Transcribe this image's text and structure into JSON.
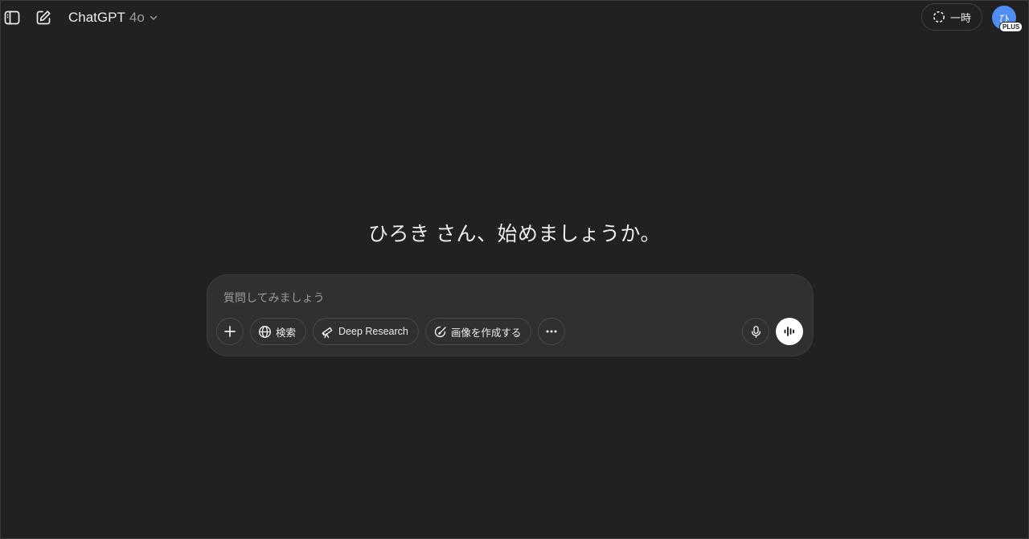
{
  "header": {
    "model_name": "ChatGPT",
    "model_version": "4o",
    "temporary_label": "一時",
    "avatar_initial": "ひ",
    "plan_badge": "PLUS"
  },
  "main": {
    "greeting": "ひろき さん、始めましょうか。"
  },
  "composer": {
    "placeholder": "質問してみましょう",
    "value": "",
    "tools": {
      "search_label": "検索",
      "deep_research_label": "Deep Research",
      "create_image_label": "画像を作成する"
    }
  },
  "icons": {
    "sidebar": "sidebar-toggle-icon",
    "new_chat": "edit-icon",
    "model_dropdown": "chevron-down-icon",
    "temporary": "dashed-circle-icon",
    "attach": "plus-icon",
    "search": "globe-icon",
    "deep_research": "telescope-icon",
    "create_image": "palette-icon",
    "more": "ellipsis-icon",
    "dictate": "microphone-icon",
    "voice_mode": "sound-wave-icon"
  },
  "colors": {
    "background": "#212121",
    "composer": "#303030",
    "avatar": "#4f8ef0",
    "text": "#ececec",
    "muted_text": "#9b9b9b"
  }
}
